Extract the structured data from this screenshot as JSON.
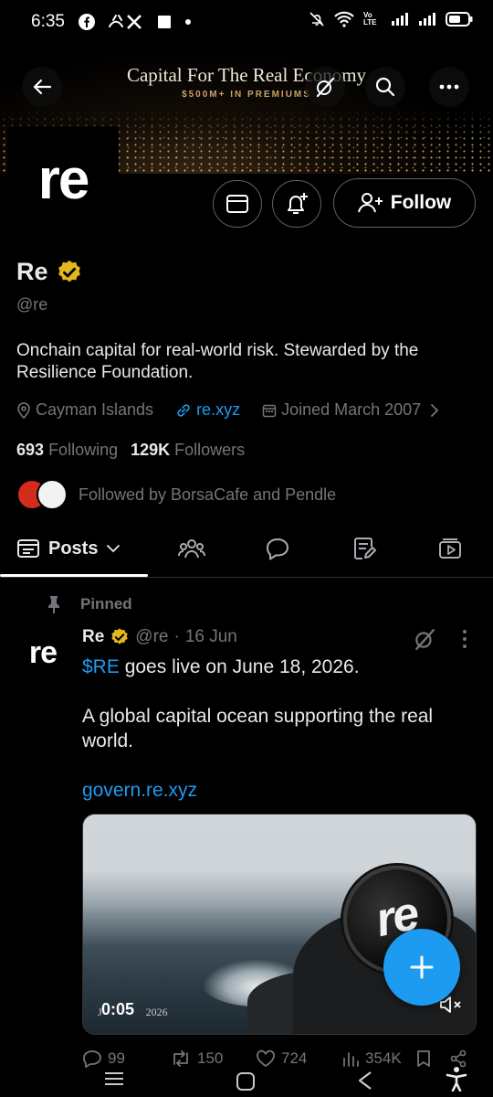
{
  "status_bar": {
    "time": "6:35",
    "volte": "Vo LTE"
  },
  "banner": {
    "title": "Capital For The Real Economy",
    "subtitle": "$500M+ IN PREMIUMS"
  },
  "profile": {
    "avatar_text": "re",
    "name": "Re",
    "handle": "@re",
    "bio": "Onchain capital for real-world risk. Stewarded by the Resilience Foundation.",
    "location": "Cayman Islands",
    "website": "re.xyz",
    "joined": "Joined March 2007",
    "following_count": "693",
    "following_label": "Following",
    "followers_count": "129K",
    "followers_label": "Followers",
    "followed_by": "Followed by BorsaCafe and Pendle",
    "follow_button": "Follow"
  },
  "tabs": {
    "posts_label": "Posts"
  },
  "post": {
    "pinned_label": "Pinned",
    "avatar_text": "re",
    "author_name": "Re",
    "author_handle": "@re",
    "separator": "·",
    "date": "16 Jun",
    "cashtag": "$RE",
    "line1_rest": " goes live on June 18, 2026.",
    "line2": "A global capital ocean supporting the real world.",
    "link": "govern.re.xyz",
    "media": {
      "coin_text": "re",
      "date_stamp": "J",
      "date_stamp_tail": "2026",
      "video_time": "0:05"
    },
    "replies": "99",
    "reposts": "150",
    "likes": "724",
    "views": "354K"
  },
  "colors": {
    "accent": "#1d9bf0",
    "verified_gold": "#e2b719",
    "muted": "#71767b",
    "text": "#e7e9ea",
    "border": "#536471"
  }
}
